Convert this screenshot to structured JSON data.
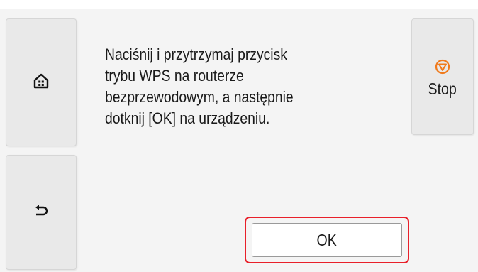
{
  "dialog": {
    "message": "Naciśnij i przytrzymaj przycisk\ntrybu WPS na routerze\nbezprzewodowym, a następnie\ndotknij [OK] na urządzeniu."
  },
  "nav": {
    "home_icon": "home-icon",
    "back_icon": "back-arrow-icon"
  },
  "stop_button": {
    "label": "Stop",
    "icon": "stop-icon",
    "icon_color": "#f07a1c"
  },
  "ok_button": {
    "label": "OK",
    "highlight_color": "#e8202a"
  }
}
